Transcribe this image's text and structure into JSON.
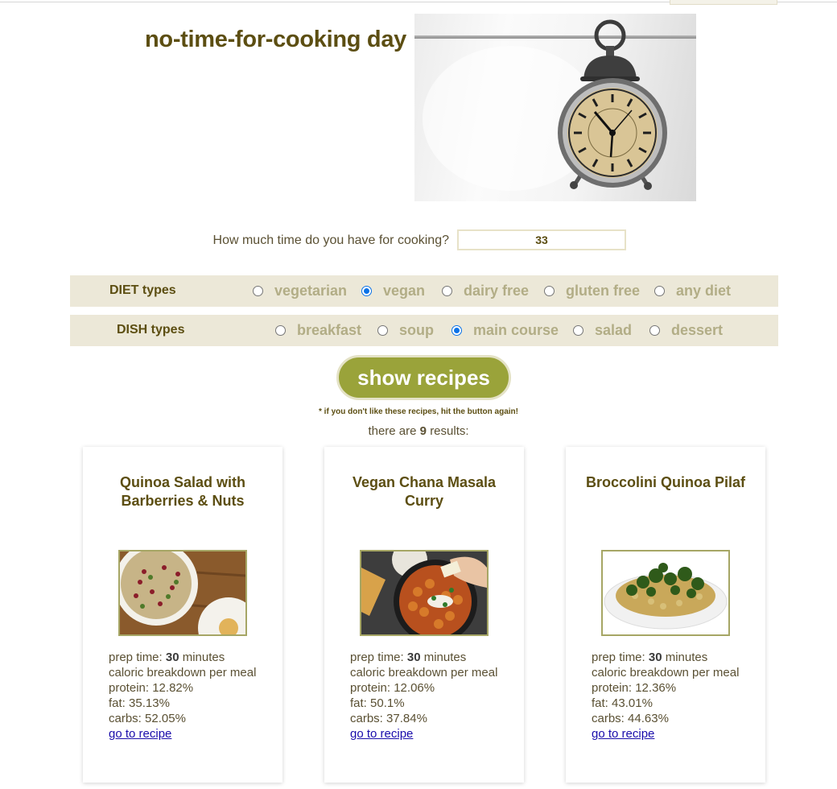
{
  "page": {
    "title": "no-time-for-cooking day"
  },
  "time_question": {
    "label": "How much time do you have for cooking?",
    "value": "33"
  },
  "diet": {
    "label": "DIET types",
    "options": [
      {
        "label": "vegetarian",
        "checked": false
      },
      {
        "label": "vegan",
        "checked": true
      },
      {
        "label": "dairy free",
        "checked": false
      },
      {
        "label": "gluten free",
        "checked": false
      },
      {
        "label": "any diet",
        "checked": false
      }
    ]
  },
  "dish": {
    "label": "DISH types",
    "options": [
      {
        "label": "breakfast",
        "checked": false
      },
      {
        "label": "soup",
        "checked": false
      },
      {
        "label": "main course",
        "checked": true
      },
      {
        "label": "salad",
        "checked": false
      },
      {
        "label": "dessert",
        "checked": false
      }
    ]
  },
  "action": {
    "button_label": "show recipes",
    "hint": "* if you don't like these recipes, hit the button again!",
    "results_prefix": "there are",
    "results_count": "9",
    "results_suffix": "results:"
  },
  "card_labels": {
    "prep_prefix": "prep time:",
    "prep_suffix": "minutes",
    "caloric": "caloric breakdown per meal",
    "protein": "protein:",
    "fat": "fat:",
    "carbs": "carbs:",
    "link": "go to recipe"
  },
  "recipes": [
    {
      "title": "Quinoa Salad with Barberries & Nuts",
      "prep_time": "30",
      "protein": "12.82%",
      "fat": "35.13%",
      "carbs": "52.05%"
    },
    {
      "title": "Vegan Chana Masala Curry",
      "prep_time": "30",
      "protein": "12.06%",
      "fat": "50.1%",
      "carbs": "37.84%"
    },
    {
      "title": "Broccolini Quinoa Pilaf",
      "prep_time": "30",
      "protein": "12.36%",
      "fat": "43.01%",
      "carbs": "44.63%"
    }
  ],
  "colors": {
    "accent": "#9aa33a",
    "title": "#5c4e12",
    "bar_bg": "#ece8d8",
    "radio_selected": "#0b72e7",
    "link": "#1a0dab"
  }
}
